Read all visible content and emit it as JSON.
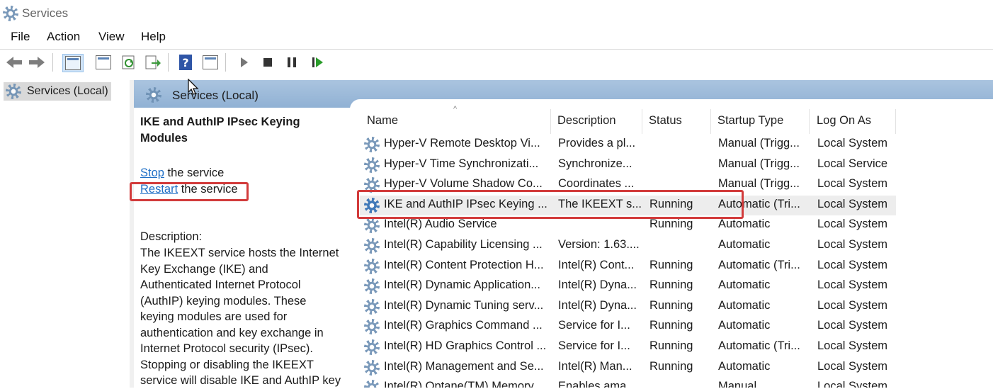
{
  "window": {
    "title": "Services"
  },
  "menu": [
    "File",
    "Action",
    "View",
    "Help"
  ],
  "toolbar": {
    "buttons": [
      "back-icon",
      "forward-icon",
      "show-hide-tree-icon",
      "properties-icon",
      "refresh-icon",
      "export-list-icon",
      "help-icon",
      "action-pane-icon",
      "start-service-icon",
      "stop-service-icon",
      "pause-service-icon",
      "resume-service-icon"
    ]
  },
  "tree": {
    "root_label": "Services (Local)"
  },
  "header": {
    "label": "Services (Local)"
  },
  "detail": {
    "title": "IKE and AuthIP IPsec Keying Modules",
    "stop_link": "Stop",
    "stop_suffix": " the service",
    "restart_link": "Restart",
    "restart_suffix": " the service",
    "description_label": "Description:",
    "description_lines": [
      "The IKEEXT service hosts the Internet",
      "Key Exchange (IKE) and",
      "Authenticated Internet Protocol",
      "(AuthIP) keying modules. These",
      "keying modules are used for",
      "authentication and key exchange in",
      "Internet Protocol security (IPsec).",
      "Stopping or disabling the IKEEXT",
      "service will disable IKE and AuthIP key"
    ]
  },
  "table": {
    "columns": [
      "Name",
      "Description",
      "Status",
      "Startup Type",
      "Log On As"
    ],
    "rows": [
      {
        "name": "Hyper-V Remote Desktop Vi...",
        "description": "Provides a pl...",
        "status": "",
        "startup": "Manual (Trigg...",
        "logon": "Local System"
      },
      {
        "name": "Hyper-V Time Synchronizati...",
        "description": "Synchronize...",
        "status": "",
        "startup": "Manual (Trigg...",
        "logon": "Local Service"
      },
      {
        "name": "Hyper-V Volume Shadow Co...",
        "description": "Coordinates ...",
        "status": "",
        "startup": "Manual (Trigg...",
        "logon": "Local System"
      },
      {
        "name": "IKE and AuthIP IPsec Keying ...",
        "description": "The IKEEXT s...",
        "status": "Running",
        "startup": "Automatic (Tri...",
        "logon": "Local System",
        "selected": true
      },
      {
        "name": "Intel(R) Audio Service",
        "description": "",
        "status": "Running",
        "startup": "Automatic",
        "logon": "Local System"
      },
      {
        "name": "Intel(R) Capability Licensing ...",
        "description": "Version: 1.63....",
        "status": "",
        "startup": "Automatic",
        "logon": "Local System"
      },
      {
        "name": "Intel(R) Content Protection H...",
        "description": "Intel(R) Cont...",
        "status": "Running",
        "startup": "Automatic (Tri...",
        "logon": "Local System"
      },
      {
        "name": "Intel(R) Dynamic Application...",
        "description": "Intel(R) Dyna...",
        "status": "Running",
        "startup": "Automatic",
        "logon": "Local System"
      },
      {
        "name": "Intel(R) Dynamic Tuning serv...",
        "description": "Intel(R) Dyna...",
        "status": "Running",
        "startup": "Automatic",
        "logon": "Local System"
      },
      {
        "name": "Intel(R) Graphics Command ...",
        "description": "Service for I...",
        "status": "Running",
        "startup": "Automatic",
        "logon": "Local System"
      },
      {
        "name": "Intel(R) HD Graphics Control ...",
        "description": "Service for I...",
        "status": "Running",
        "startup": "Automatic (Tri...",
        "logon": "Local System"
      },
      {
        "name": "Intel(R) Management and Se...",
        "description": "Intel(R) Man...",
        "status": "Running",
        "startup": "Automatic",
        "logon": "Local System"
      },
      {
        "name": "Intel(R) Optane(TM) Memory ...",
        "description": "Enables ama...",
        "status": "",
        "startup": "Manual",
        "logon": "Local System"
      }
    ]
  },
  "colors": {
    "highlight_box": "#d23b3b",
    "link": "#1f6fc6",
    "header_bar": "#9dbbdb"
  }
}
